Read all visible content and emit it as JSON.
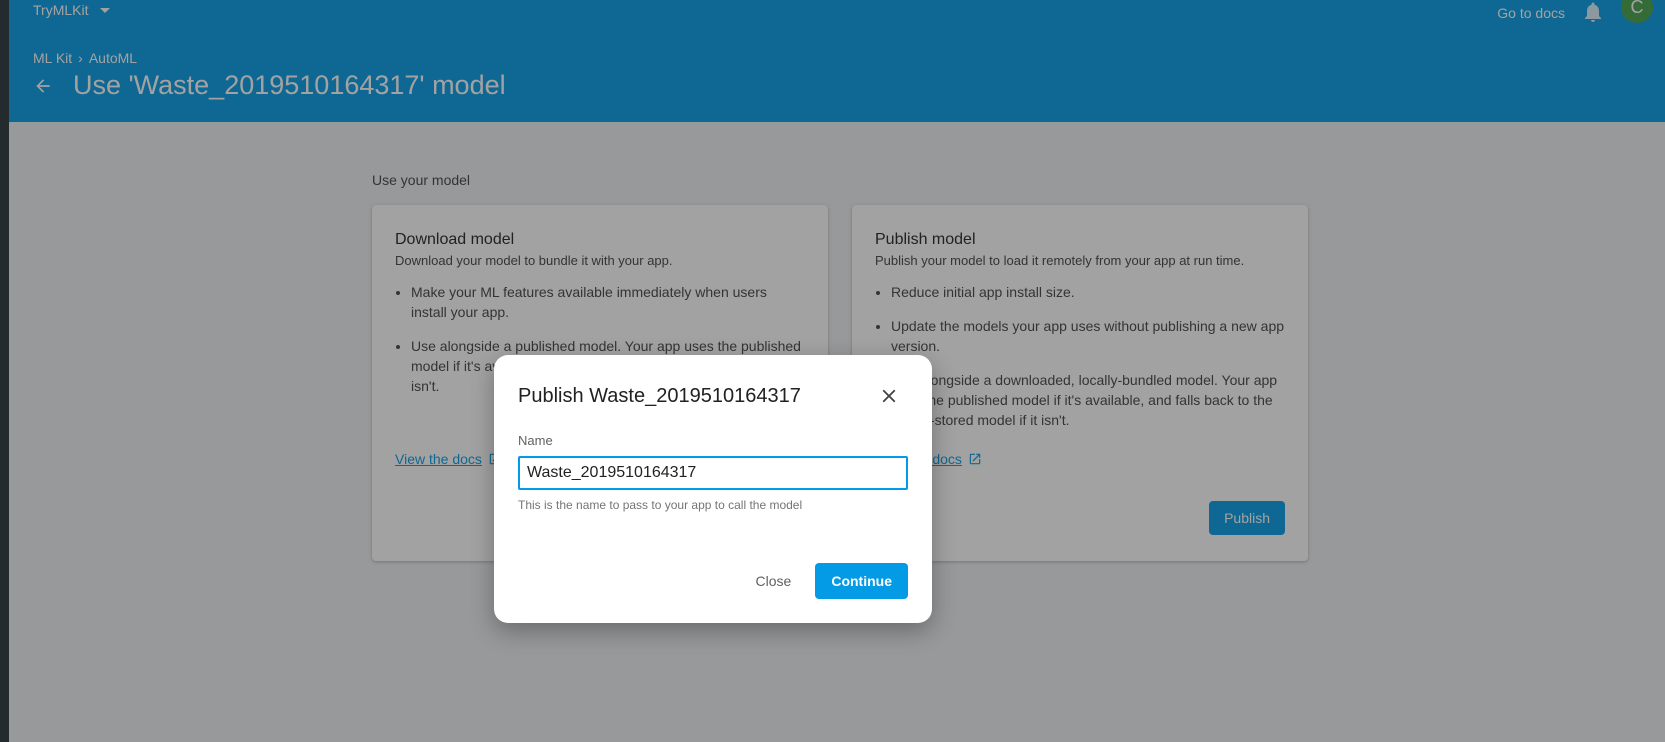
{
  "header": {
    "project_name": "TryMLKit",
    "go_to_docs": "Go to docs",
    "avatar_letter": "C",
    "breadcrumb": [
      "ML Kit",
      "AutoML"
    ],
    "breadcrumb_sep": "›",
    "title": "Use 'Waste_2019510164317' model"
  },
  "main": {
    "section_label": "Use your model",
    "download_card": {
      "title": "Download model",
      "description": "Download your model to bundle it with your app.",
      "bullets": [
        "Make your ML features available immediately when users install your app.",
        "Use alongside a published model. Your app uses the published model if it's available, and falls back to the bundled model if it isn't."
      ],
      "docs_link": "View the docs"
    },
    "publish_card": {
      "title": "Publish model",
      "description": "Publish your model to load it remotely from your app at run time.",
      "bullets": [
        "Reduce initial app install size.",
        "Update the models your app uses without publishing a new app version.",
        "Use alongside a downloaded, locally-bundled model. Your app uses the published model if it's available, and falls back to the locally-stored model if it isn't."
      ],
      "docs_link": "View the docs",
      "publish_button": "Publish"
    }
  },
  "dialog": {
    "title": "Publish Waste_2019510164317",
    "name_label": "Name",
    "name_value": "Waste_2019510164317",
    "hint": "This is the name to pass to your app to call the model",
    "close_button": "Close",
    "continue_button": "Continue"
  },
  "colors": {
    "header": "#039be5",
    "accent": "#039be5",
    "avatar": "#43a047"
  }
}
